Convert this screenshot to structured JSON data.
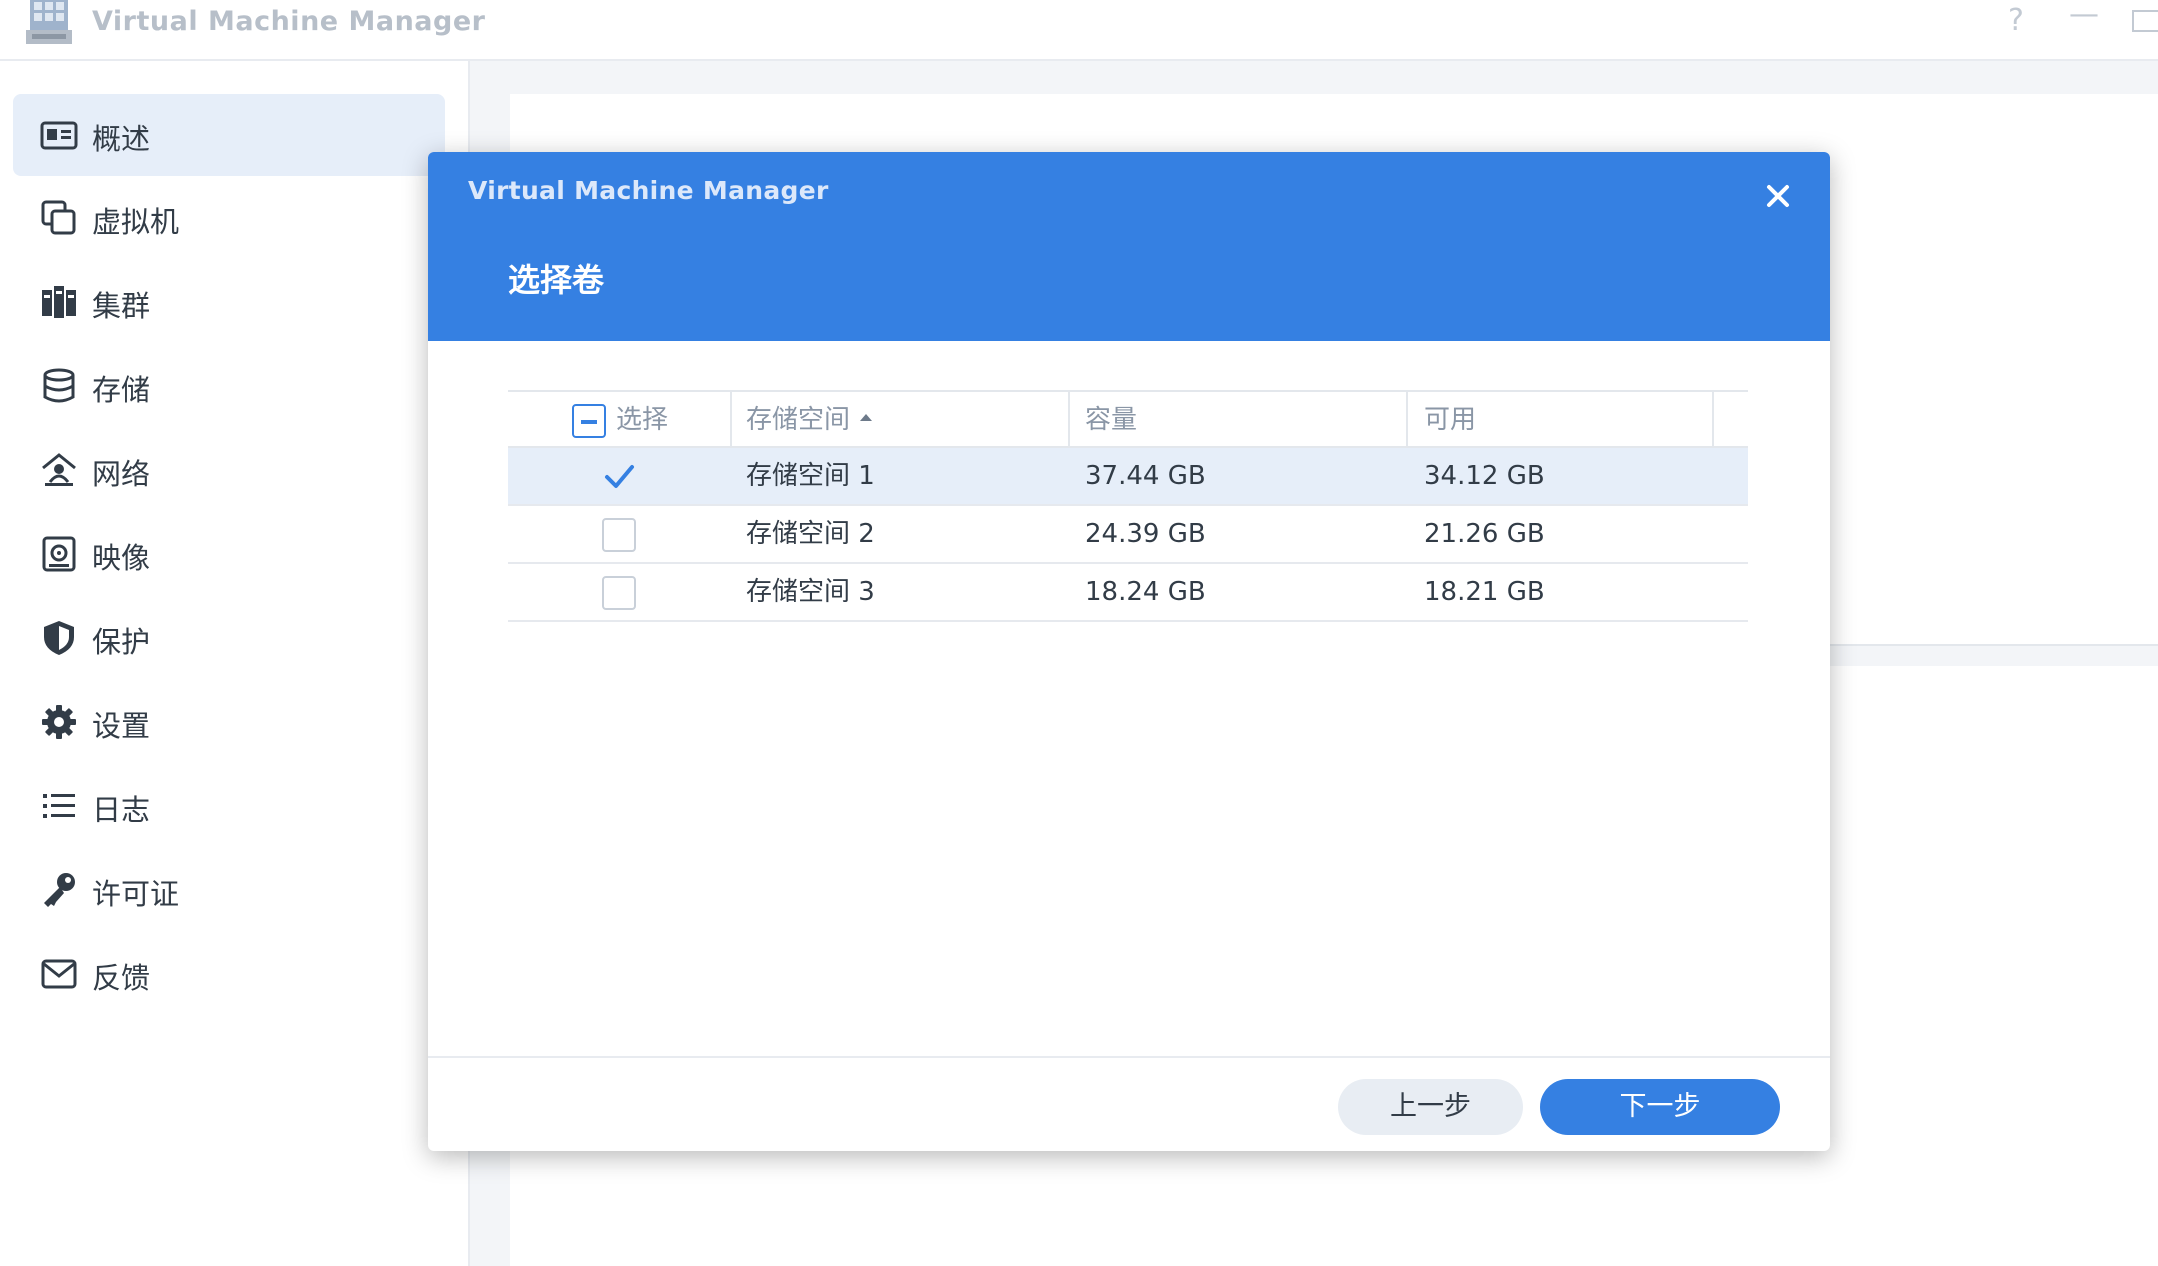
{
  "window": {
    "app_title": "Virtual Machine Manager",
    "help_glyph": "?",
    "minimize_glyph": "—"
  },
  "sidebar": {
    "items": [
      {
        "label": "概述",
        "icon": "overview-icon",
        "active": true
      },
      {
        "label": "虚拟机",
        "icon": "virtual-machine-icon",
        "active": false
      },
      {
        "label": "集群",
        "icon": "cluster-icon",
        "active": false
      },
      {
        "label": "存储",
        "icon": "storage-icon",
        "active": false
      },
      {
        "label": "网络",
        "icon": "network-icon",
        "active": false
      },
      {
        "label": "映像",
        "icon": "image-icon",
        "active": false
      },
      {
        "label": "保护",
        "icon": "shield-icon",
        "active": false
      },
      {
        "label": "设置",
        "icon": "gear-icon",
        "active": false
      },
      {
        "label": "日志",
        "icon": "list-icon",
        "active": false
      },
      {
        "label": "许可证",
        "icon": "key-icon",
        "active": false
      },
      {
        "label": "反馈",
        "icon": "mail-icon",
        "active": false
      }
    ]
  },
  "dialog": {
    "app_title": "Virtual Machine Manager",
    "step_title": "选择卷",
    "close_icon": "close-icon",
    "table": {
      "columns": [
        "选择",
        "存储空间",
        "容量",
        "可用"
      ],
      "sort_column": "存储空间",
      "sort_direction": "ascending",
      "rows": [
        {
          "selected": true,
          "name": "存储空间 1",
          "capacity": "37.44 GB",
          "available": "34.12 GB"
        },
        {
          "selected": false,
          "name": "存储空间 2",
          "capacity": "24.39 GB",
          "available": "21.26 GB"
        },
        {
          "selected": false,
          "name": "存储空间 3",
          "capacity": "18.24 GB",
          "available": "18.21 GB"
        }
      ]
    },
    "buttons": {
      "prev_label": "上一步",
      "next_label": "下一步"
    }
  },
  "colors": {
    "accent": "#3580e2",
    "selected_row": "#e6eef9",
    "sidebar_active": "#e6eef9",
    "prev_button": "#e8edf3"
  }
}
